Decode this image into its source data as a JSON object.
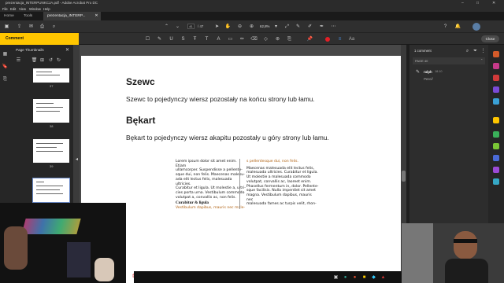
{
  "window": {
    "title": "prezentacja_INTERPUNKCJA.pdf - Adobe Acrobat Pro DC",
    "min": "–",
    "max": "□",
    "close": "✕"
  },
  "menu": [
    "File",
    "Edit",
    "View",
    "Window",
    "Help"
  ],
  "tabs": {
    "home": "Home",
    "tools": "Tools",
    "doc": "prezentacja_INTERP...",
    "doc_close": "✕"
  },
  "toolbar": {
    "page_current": "41",
    "page_total": "/ 47",
    "zoom": "62,8%"
  },
  "comment_bar": {
    "label": "Comment",
    "close": "Close"
  },
  "thumbnails": {
    "header": "Page Thumbnails",
    "pages": [
      "37",
      "38",
      "39",
      "40"
    ]
  },
  "document": {
    "h1": "Szewc",
    "p1": "Szewc to pojedynczy wiersz pozostały na końcu strony lub łamu.",
    "h2": "Bękart",
    "p2": "Bękart to pojedynczy wiersz akapitu pozostały u góry strony lub łamu.",
    "left_col": [
      "Lorem ipsum dolor sit amet enim. Etiam",
      "ullamcorper. Suspendisse a pellente-",
      "sque dui, non felis. Maecenas malesu-",
      "ada elit lectus felis, malesuada ultricies.",
      "Curabitur et ligula. Ut molestie a, ultri-",
      "cies porta urna. Vestibulum commodo",
      "volutpat a, convallis ac, non felis."
    ],
    "left_head": "Curabitur & ligula",
    "left_tail": "Vestibulum dapibus, mauris nec male-",
    "right_top": "s pellentesque dui, non felis.",
    "right_col": [
      "Maecenas malesuada elit lectus felis,",
      "malesuada ultricies. Curabitur et ligula.",
      "Ut molestie a malesuada commodo",
      "volutpat, convallis ac, laoreet enim.",
      "Phasellus fermentum in, dolor. Pellente-",
      "sque facilisis. Nulla imperdiet sit amet",
      "magna. Vestibulum dapibus, mauris nec",
      "malesuada fames ac turpis velit, rhon-"
    ]
  },
  "comments_panel": {
    "count": "1 comment",
    "page": "PAGE 40",
    "author": "ralph",
    "time": "18:10",
    "type": "Pencil"
  },
  "colors": {
    "accent": "#ffc600",
    "panel": "#2d2d2d",
    "dark": "#1e1e1e"
  }
}
